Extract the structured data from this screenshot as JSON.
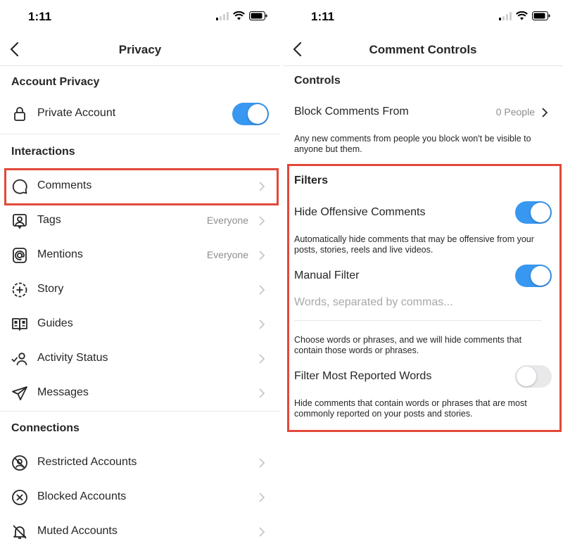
{
  "left": {
    "status": {
      "time": "1:11"
    },
    "title": "Privacy",
    "account_privacy": {
      "heading": "Account Privacy",
      "private_account": {
        "label": "Private Account",
        "on": true
      }
    },
    "interactions": {
      "heading": "Interactions",
      "items": [
        {
          "label": "Comments",
          "value": "",
          "icon": "comment-bubble-icon"
        },
        {
          "label": "Tags",
          "value": "Everyone",
          "icon": "tag-person-icon"
        },
        {
          "label": "Mentions",
          "value": "Everyone",
          "icon": "at-sign-icon"
        },
        {
          "label": "Story",
          "value": "",
          "icon": "story-add-icon"
        },
        {
          "label": "Guides",
          "value": "",
          "icon": "guide-book-icon"
        },
        {
          "label": "Activity Status",
          "value": "",
          "icon": "activity-status-icon"
        },
        {
          "label": "Messages",
          "value": "",
          "icon": "paper-plane-icon"
        }
      ]
    },
    "connections": {
      "heading": "Connections",
      "items": [
        {
          "label": "Restricted Accounts",
          "icon": "restricted-icon"
        },
        {
          "label": "Blocked Accounts",
          "icon": "blocked-icon"
        },
        {
          "label": "Muted Accounts",
          "icon": "muted-bell-icon"
        }
      ]
    }
  },
  "right": {
    "status": {
      "time": "1:11"
    },
    "title": "Comment Controls",
    "controls": {
      "heading": "Controls",
      "block_comments": {
        "label": "Block Comments From",
        "value": "0 People"
      },
      "block_desc": "Any new comments from people you block won't be visible to anyone but them."
    },
    "filters": {
      "heading": "Filters",
      "hide_offensive": {
        "label": "Hide Offensive Comments",
        "on": true
      },
      "hide_offensive_desc": "Automatically hide comments that may be offensive from your posts, stories, reels and live videos.",
      "manual_filter": {
        "label": "Manual Filter",
        "on": true
      },
      "manual_placeholder": "Words, separated by commas...",
      "manual_desc": "Choose words or phrases, and we will hide comments that contain those words or phrases.",
      "most_reported": {
        "label": "Filter Most Reported Words",
        "on": false
      },
      "most_reported_desc": "Hide comments that contain words or phrases that are most commonly reported on your posts and stories."
    }
  },
  "colors": {
    "toggle_on": "#3897f0",
    "highlight": "#e2483a",
    "muted_text": "#8e8e8e"
  }
}
